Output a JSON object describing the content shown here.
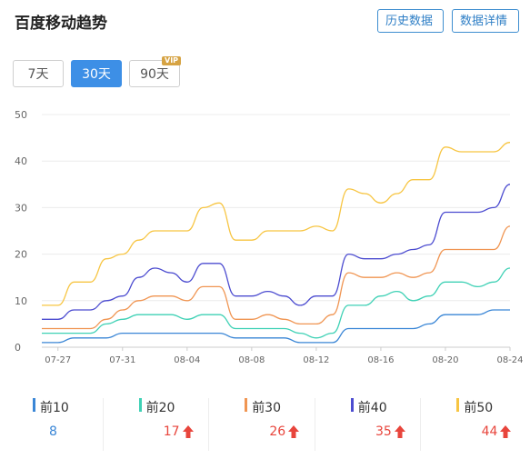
{
  "header": {
    "title": "百度移动趋势",
    "history_button": "历史数据",
    "detail_button": "数据详情"
  },
  "range": {
    "options": [
      "7天",
      "30天",
      "90天"
    ],
    "selected": "30天",
    "vip_badge": "VIP"
  },
  "colors": {
    "top10": "#3a86d6",
    "top20": "#3fd1b5",
    "top30": "#f09552",
    "top40": "#4c4cd0",
    "top50": "#f7c542",
    "up": "#e8453c"
  },
  "chart_data": {
    "type": "line",
    "x": [
      "07-26",
      "07-27",
      "07-28",
      "07-29",
      "07-30",
      "07-31",
      "08-01",
      "08-02",
      "08-03",
      "08-04",
      "08-05",
      "08-06",
      "08-07",
      "08-08",
      "08-09",
      "08-10",
      "08-11",
      "08-12",
      "08-13",
      "08-14",
      "08-15",
      "08-16",
      "08-17",
      "08-18",
      "08-19",
      "08-20",
      "08-21",
      "08-22",
      "08-23",
      "08-24"
    ],
    "x_ticks": [
      "07-27",
      "07-31",
      "08-04",
      "08-08",
      "08-12",
      "08-16",
      "08-20",
      "08-24"
    ],
    "y_ticks": [
      0,
      10,
      20,
      30,
      40,
      50
    ],
    "ylim": [
      0,
      50
    ],
    "grid": true,
    "series": [
      {
        "name": "前10",
        "values": [
          1,
          1,
          2,
          2,
          2,
          3,
          3,
          3,
          3,
          3,
          3,
          3,
          2,
          2,
          2,
          2,
          1,
          1,
          1,
          4,
          4,
          4,
          4,
          4,
          5,
          7,
          7,
          7,
          8,
          8
        ]
      },
      {
        "name": "前20",
        "values": [
          3,
          3,
          3,
          3,
          5,
          6,
          7,
          7,
          7,
          6,
          7,
          7,
          4,
          4,
          4,
          4,
          3,
          2,
          3,
          9,
          9,
          11,
          12,
          10,
          11,
          14,
          14,
          13,
          14,
          17
        ]
      },
      {
        "name": "前30",
        "values": [
          4,
          4,
          4,
          4,
          6,
          8,
          10,
          11,
          11,
          10,
          13,
          13,
          6,
          6,
          7,
          6,
          5,
          5,
          7,
          16,
          15,
          15,
          16,
          15,
          16,
          21,
          21,
          21,
          21,
          26
        ]
      },
      {
        "name": "前40",
        "values": [
          6,
          6,
          8,
          8,
          10,
          11,
          15,
          17,
          16,
          14,
          18,
          18,
          11,
          11,
          12,
          11,
          9,
          11,
          11,
          20,
          19,
          19,
          20,
          21,
          22,
          29,
          29,
          29,
          30,
          35
        ]
      },
      {
        "name": "前50",
        "values": [
          9,
          9,
          14,
          14,
          19,
          20,
          23,
          25,
          25,
          25,
          30,
          31,
          23,
          23,
          25,
          25,
          25,
          26,
          25,
          34,
          33,
          31,
          33,
          36,
          36,
          43,
          42,
          42,
          42,
          44
        ]
      }
    ]
  },
  "legend": [
    {
      "name": "前10",
      "value": "8",
      "trend": "none",
      "color_key": "top10"
    },
    {
      "name": "前20",
      "value": "17",
      "trend": "up",
      "color_key": "top20"
    },
    {
      "name": "前30",
      "value": "26",
      "trend": "up",
      "color_key": "top30"
    },
    {
      "name": "前40",
      "value": "35",
      "trend": "up",
      "color_key": "top40"
    },
    {
      "name": "前50",
      "value": "44",
      "trend": "up",
      "color_key": "top50"
    }
  ]
}
